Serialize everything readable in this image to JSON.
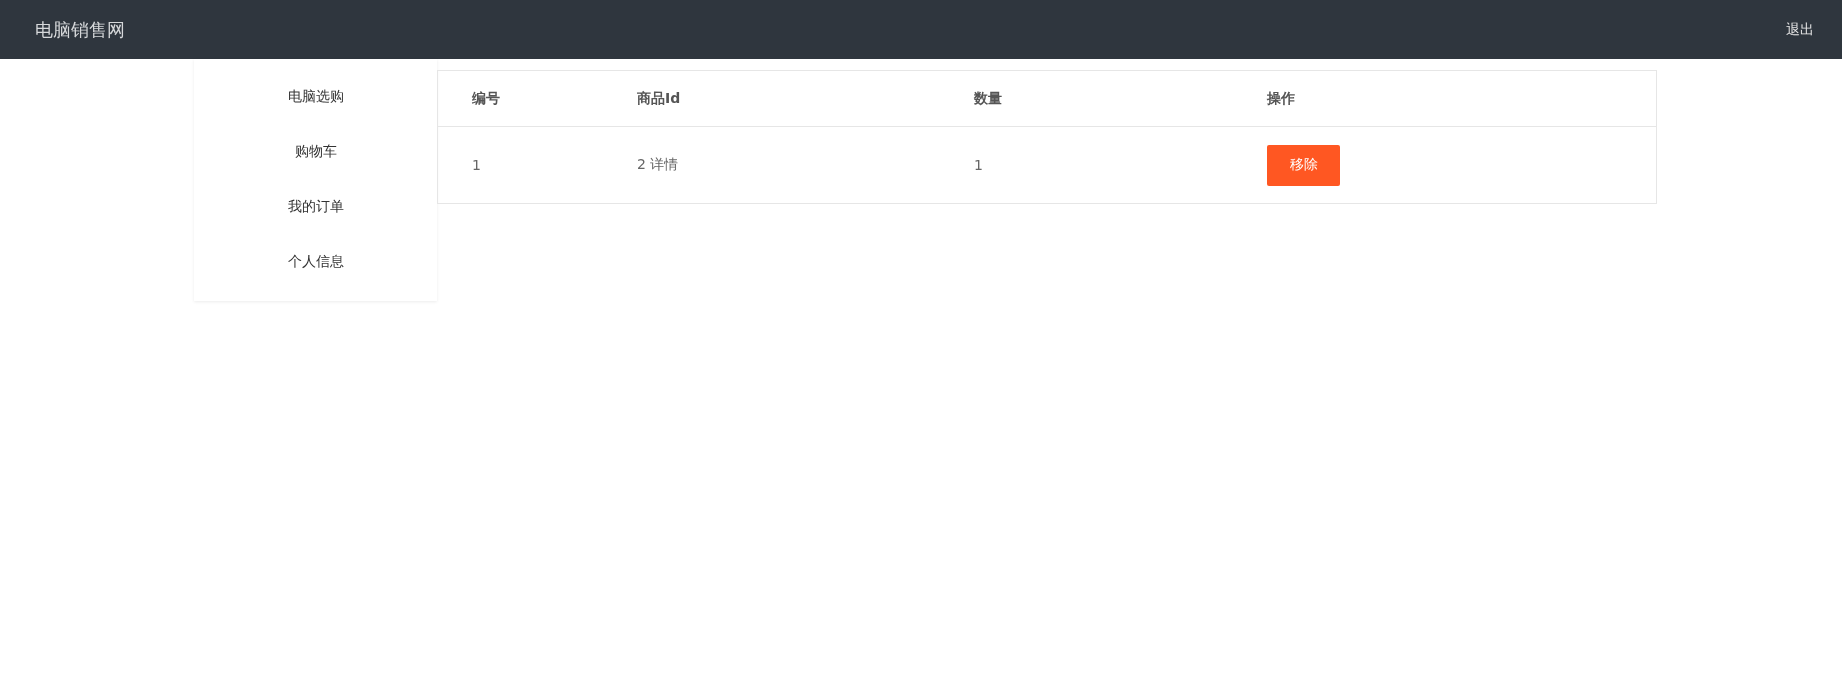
{
  "header": {
    "brand": "电脑销售网",
    "logout": "退出"
  },
  "sidebar": {
    "items": [
      {
        "label": "电脑选购",
        "selected": false
      },
      {
        "label": "购物车",
        "selected": false
      },
      {
        "label": "我的订单",
        "selected": false
      },
      {
        "label": "个人信息",
        "selected": false
      }
    ]
  },
  "table": {
    "columns": [
      "编号",
      "商品Id",
      "数量",
      "操作"
    ],
    "rows": [
      {
        "cells": [
          "1",
          "2 详情",
          "1"
        ],
        "action": "移除"
      }
    ]
  }
}
